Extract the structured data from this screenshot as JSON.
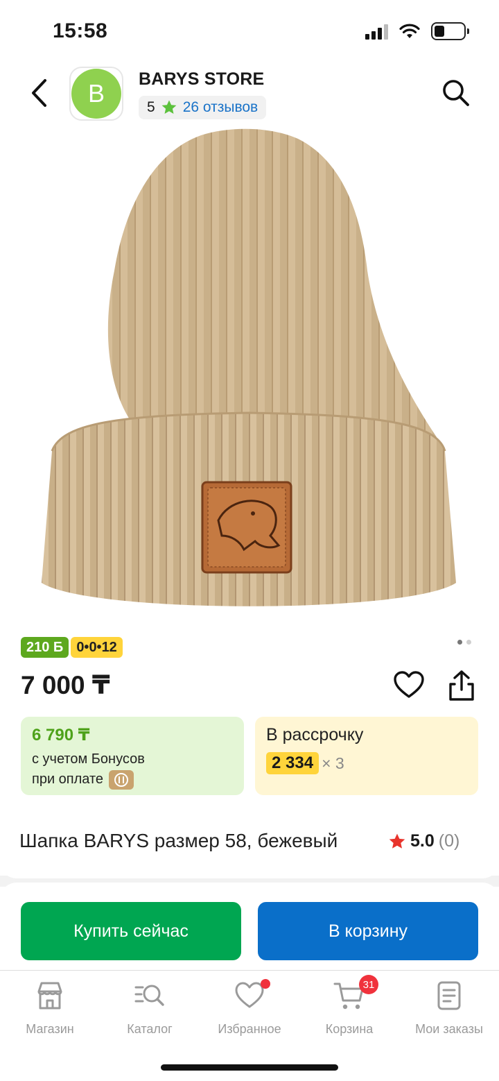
{
  "status_bar": {
    "time": "15:58"
  },
  "header": {
    "store_initial": "B",
    "store_name": "BARYS STORE",
    "rating": "5",
    "reviews": "26 отзывов"
  },
  "product": {
    "badges": {
      "bonus": "210 Б",
      "installment": "0•0•12"
    },
    "price": "7 000 ₸",
    "bonus_card": {
      "price": "6 790 ₸",
      "line1": "с учетом Бонусов",
      "line2": "при оплате"
    },
    "installment_card": {
      "title": "В рассрочку",
      "amount": "2 334",
      "multiplier": "× 3"
    },
    "title": "Шапка BARYS размер 58, бежевый",
    "rating": "5.0",
    "rating_count": "(0)",
    "image_pager": {
      "count": 2,
      "active": 1
    }
  },
  "actions": {
    "buy_now": "Купить сейчас",
    "add_to_cart": "В корзину"
  },
  "bottom_nav": {
    "items": [
      {
        "label": "Магазин",
        "icon": "store-icon"
      },
      {
        "label": "Каталог",
        "icon": "catalog-search-icon"
      },
      {
        "label": "Избранное",
        "icon": "heart-icon"
      },
      {
        "label": "Корзина",
        "icon": "cart-icon",
        "badge": "31"
      },
      {
        "label": "Мои заказы",
        "icon": "orders-icon"
      }
    ]
  },
  "colors": {
    "accent_green": "#00a651",
    "accent_blue": "#0a6fc9",
    "bonus_green": "#5da81e",
    "installment_yellow": "#ffd43b",
    "badge_red": "#f0323c"
  }
}
